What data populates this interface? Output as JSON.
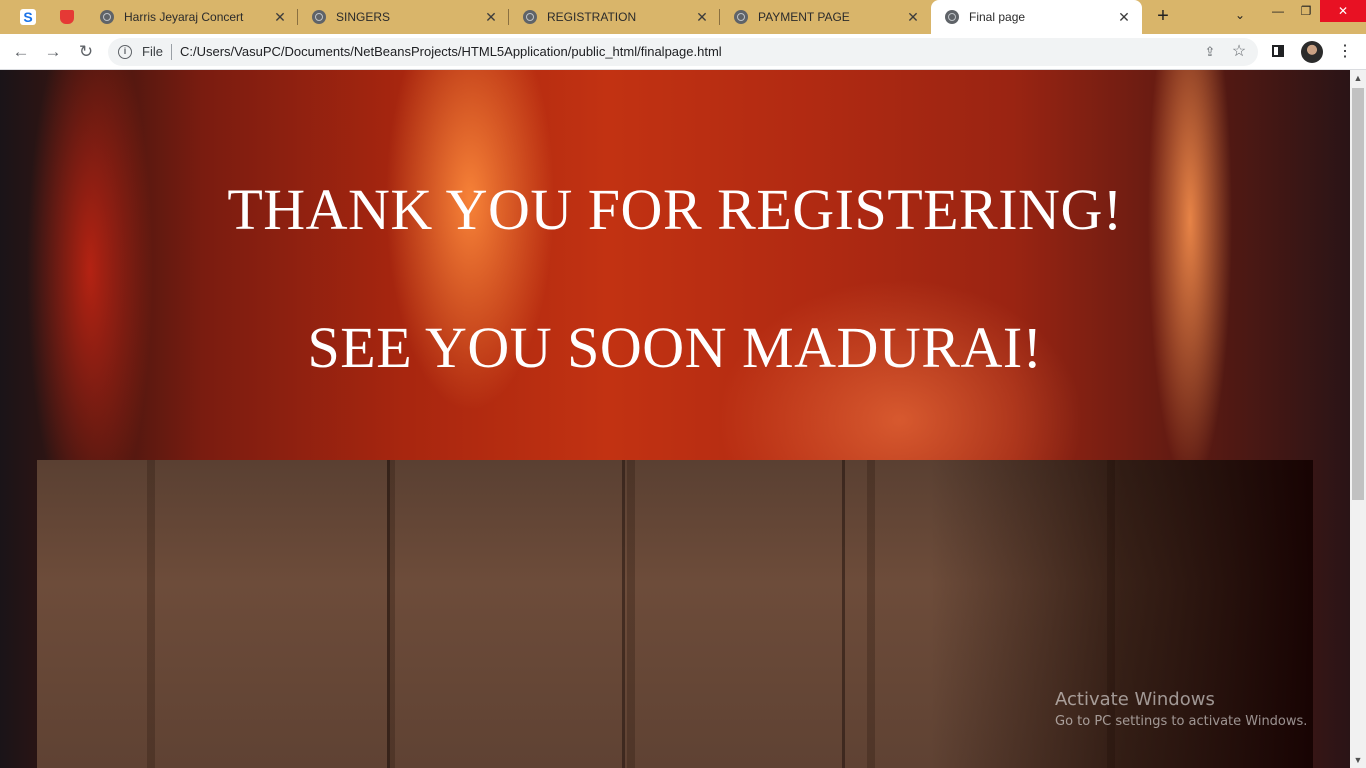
{
  "browser": {
    "pinned_tabs": [
      {
        "icon": "skype-s-icon",
        "glyph": "S"
      },
      {
        "icon": "pdf-bookmark-icon"
      }
    ],
    "tabs": [
      {
        "title": "Harris Jeyaraj Concert",
        "icon": "globe-icon",
        "active": false
      },
      {
        "title": "SINGERS",
        "icon": "globe-icon",
        "active": false
      },
      {
        "title": "REGISTRATION",
        "icon": "globe-icon",
        "active": false
      },
      {
        "title": "PAYMENT PAGE",
        "icon": "globe-icon",
        "active": false
      },
      {
        "title": "Final page",
        "icon": "globe-icon",
        "active": true
      }
    ],
    "address_bar": {
      "scheme_label": "File",
      "url": "C:/Users/VasuPC/Documents/NetBeansProjects/HTML5Application/public_html/finalpage.html"
    }
  },
  "page": {
    "headline_1": "THANK YOU FOR REGISTERING!",
    "headline_2": "SEE YOU SOON MADURAI!"
  },
  "os_overlay": {
    "activate_title": "Activate Windows",
    "activate_subtitle": "Go to PC settings to activate Windows."
  },
  "colors": {
    "tabstrip": "#d9b56a",
    "active_tab": "#ffffff",
    "close_button": "#e81123"
  }
}
